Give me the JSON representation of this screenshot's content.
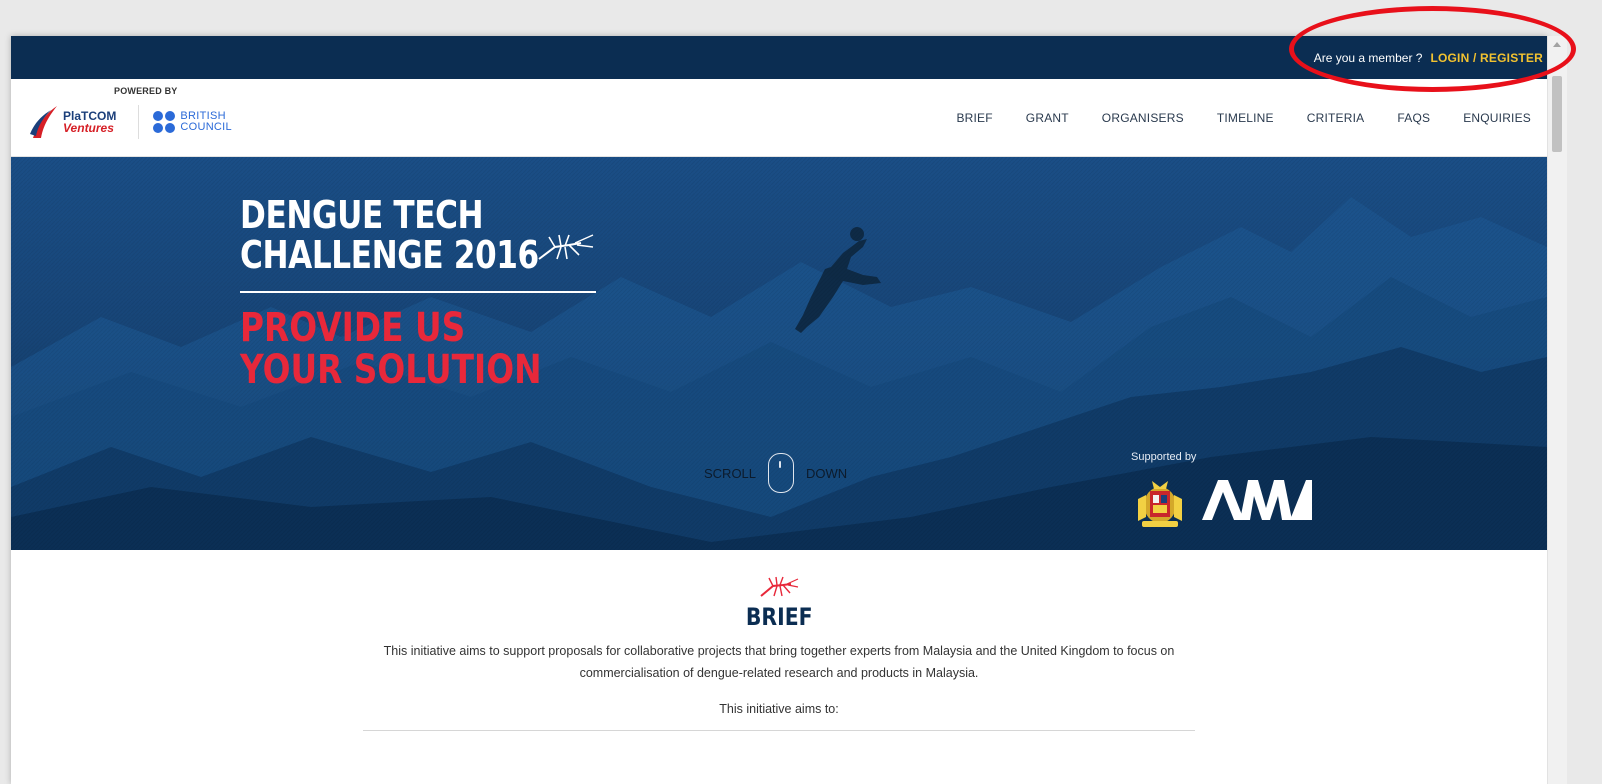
{
  "topbar": {
    "member_text": "Are you a member ?",
    "login_label": "LOGIN / REGISTER"
  },
  "header": {
    "powered_by": "POWERED BY",
    "platcom_line1": "PlaTCOM",
    "platcom_line2": "Ventures",
    "bc_line1": "BRITISH",
    "bc_line2": "COUNCIL"
  },
  "nav": {
    "items": [
      "BRIEF",
      "GRANT",
      "ORGANISERS",
      "TIMELINE",
      "CRITERIA",
      "FAQS",
      "ENQUIRIES"
    ]
  },
  "hero": {
    "title_line1": "DENGUE TECH",
    "title_line2": "CHALLENGE 2016",
    "sub_line1": "PROVIDE US",
    "sub_line2": "YOUR SOLUTION",
    "scroll_left": "SCROLL",
    "scroll_right": "DOWN",
    "supported_by": "Supported by"
  },
  "brief": {
    "title": "BRIEF",
    "text": "This initiative aims to support proposals for collaborative projects that bring together experts from Malaysia and the United Kingdom to focus on commercialisation of dengue-related research and products in Malaysia.",
    "aims_intro": "This initiative aims to:"
  },
  "colors": {
    "navy": "#0b2d52",
    "gold": "#f2c230",
    "red": "#e8283a",
    "annotation_red": "#e8101a"
  }
}
